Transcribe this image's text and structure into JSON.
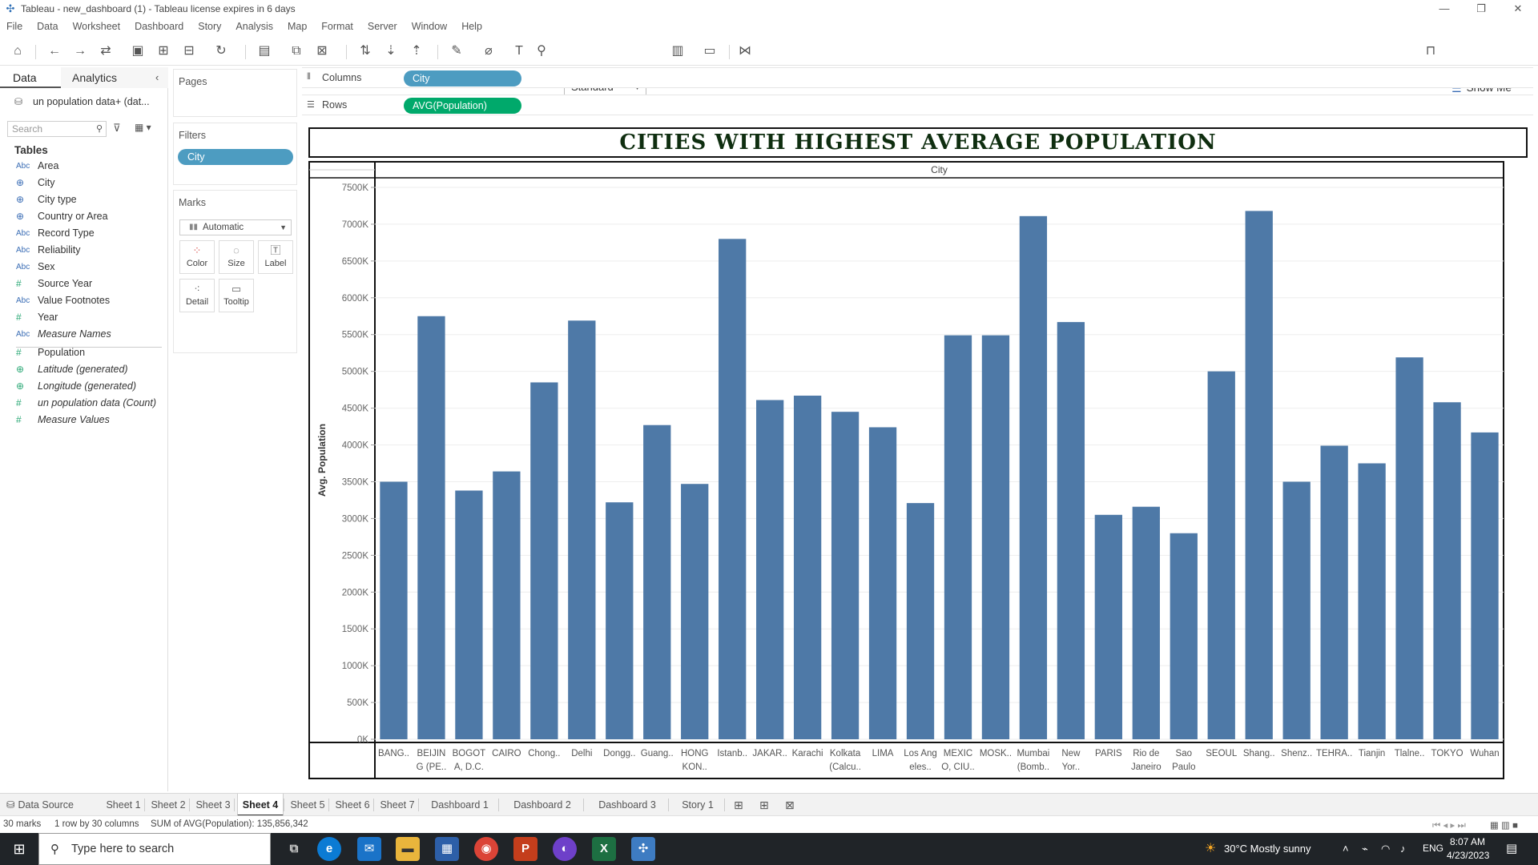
{
  "window": {
    "title": "Tableau - new_dashboard (1) - Tableau license expires in 6 days"
  },
  "menu": [
    "File",
    "Data",
    "Worksheet",
    "Dashboard",
    "Story",
    "Analysis",
    "Map",
    "Format",
    "Server",
    "Window",
    "Help"
  ],
  "toolbar": {
    "fit_value": "Standard",
    "show_me_label": "Show Me"
  },
  "data_pane": {
    "tab_data": "Data",
    "tab_analytics": "Analytics",
    "datasource": "un population data+ (dat...",
    "search_placeholder": "Search",
    "tables_heading": "Tables",
    "dimensions": [
      {
        "icon": "Abc",
        "name": "Area"
      },
      {
        "icon": "globe",
        "name": "City"
      },
      {
        "icon": "globe",
        "name": "City type"
      },
      {
        "icon": "globe",
        "name": "Country or Area"
      },
      {
        "icon": "Abc",
        "name": "Record Type"
      },
      {
        "icon": "Abc",
        "name": "Reliability"
      },
      {
        "icon": "Abc",
        "name": "Sex"
      },
      {
        "icon": "#",
        "name": "Source Year"
      },
      {
        "icon": "Abc",
        "name": "Value Footnotes"
      },
      {
        "icon": "#",
        "name": "Year"
      },
      {
        "icon": "Abc",
        "name": "Measure Names"
      }
    ],
    "measures": [
      {
        "icon": "#",
        "name": "Population"
      },
      {
        "icon": "globe",
        "name": "Latitude (generated)"
      },
      {
        "icon": "globe",
        "name": "Longitude (generated)"
      },
      {
        "icon": "#",
        "name": "un population data (Count)"
      },
      {
        "icon": "#",
        "name": "Measure Values"
      }
    ]
  },
  "cards": {
    "pages_title": "Pages",
    "filters_title": "Filters",
    "filter_pill": "City",
    "marks_title": "Marks",
    "marks_type": "Automatic",
    "mark_buttons": [
      "Color",
      "Size",
      "Label",
      "Detail",
      "Tooltip"
    ]
  },
  "shelves": {
    "columns_label": "Columns",
    "columns_pill": "City",
    "rows_label": "Rows",
    "rows_pill": "AVG(Population)"
  },
  "chart_data": {
    "type": "bar",
    "title": "CITIES WITH HIGHEST AVERAGE POPULATION",
    "xlabel": "City",
    "ylabel": "Avg. Population",
    "ylim": [
      0,
      7500000
    ],
    "yticks": [
      "0K",
      "500K",
      "1000K",
      "1500K",
      "2000K",
      "2500K",
      "3000K",
      "3500K",
      "4000K",
      "4500K",
      "5000K",
      "5500K",
      "6000K",
      "6500K",
      "7000K",
      "7500K"
    ],
    "bar_color": "#4e79a7",
    "categories": [
      [
        "BANG.."
      ],
      [
        "BEIJIN",
        "G (PE.."
      ],
      [
        "BOGOT",
        "A, D.C."
      ],
      [
        "CAIRO"
      ],
      [
        "Chong.."
      ],
      [
        "Delhi"
      ],
      [
        "Dongg.."
      ],
      [
        "Guang.."
      ],
      [
        "HONG",
        "KON.."
      ],
      [
        "Istanb.."
      ],
      [
        "JAKAR.."
      ],
      [
        "Karachi"
      ],
      [
        "Kolkata",
        "(Calcu.."
      ],
      [
        "LIMA"
      ],
      [
        "Los Ang",
        "eles.."
      ],
      [
        "MEXIC",
        "O, CIU.."
      ],
      [
        "MOSK.."
      ],
      [
        "Mumbai",
        "(Bomb.."
      ],
      [
        "New",
        "Yor.."
      ],
      [
        "PARIS"
      ],
      [
        "Rio de",
        "Janeiro"
      ],
      [
        "Sao",
        "Paulo"
      ],
      [
        "SEOUL"
      ],
      [
        "Shang.."
      ],
      [
        "Shenz.."
      ],
      [
        "TEHRA.."
      ],
      [
        "Tianjin"
      ],
      [
        "Tlalne.."
      ],
      [
        "TOKYO"
      ],
      [
        "Wuhan"
      ]
    ],
    "values": [
      3500000,
      5750000,
      3380000,
      3640000,
      4850000,
      5690000,
      3220000,
      4270000,
      3470000,
      6800000,
      4610000,
      4670000,
      4450000,
      4240000,
      3210000,
      5490000,
      5490000,
      7110000,
      5670000,
      3050000,
      3160000,
      2800000,
      5000000,
      7180000,
      3500000,
      3990000,
      3750000,
      5190000,
      4580000,
      4170000
    ]
  },
  "sheet_tabs": {
    "datasource": "Data Source",
    "tabs": [
      "Sheet 1",
      "Sheet 2",
      "Sheet 3",
      "Sheet 4",
      "Sheet 5",
      "Sheet 6",
      "Sheet 7",
      "Dashboard 1",
      "Dashboard 2",
      "Dashboard 3",
      "Story 1"
    ],
    "active": "Sheet 4"
  },
  "status": {
    "marks": "30 marks",
    "dims": "1 row by 30 columns",
    "sum": "SUM of AVG(Population): 135,856,342"
  },
  "taskbar": {
    "search_placeholder": "Type here to search",
    "weather": "30°C  Mostly sunny",
    "lang": "ENG",
    "time": "8:07 AM",
    "date": "4/23/2023"
  }
}
